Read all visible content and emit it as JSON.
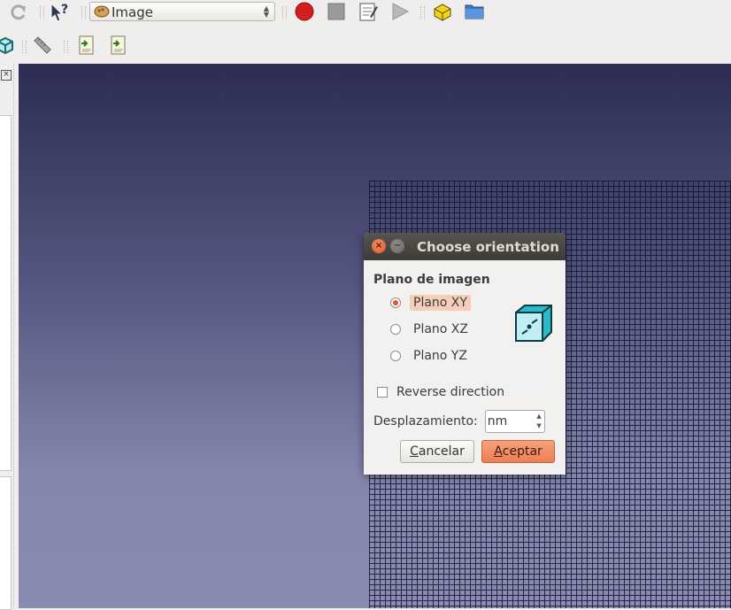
{
  "toolbar_top": {
    "workbench": {
      "selected": "Image",
      "icon": "image-workbench-icon"
    },
    "buttons": [
      "refresh-icon",
      "whats-this-icon",
      "record-macro-icon",
      "stop-macro-icon",
      "edit-macro-icon",
      "run-macro-icon",
      "part-icon",
      "folder-icon"
    ]
  },
  "toolbar_second": {
    "buttons": [
      "3d-view-icon",
      "measure-icon",
      "import-image-icon",
      "import-image-alt-icon"
    ]
  },
  "colors": {
    "accent": "#ee7e52",
    "radio_dot": "#dd5a2a",
    "title_bar": "#3d3b37",
    "viewport_top": "#2d2d52",
    "viewport_bottom": "#8a8bb0"
  },
  "dialog": {
    "title": "Choose orientation",
    "group_label": "Plano de imagen",
    "options": [
      {
        "label": "Plano XY",
        "selected": true
      },
      {
        "label": "Plano XZ",
        "selected": false
      },
      {
        "label": "Plano YZ",
        "selected": false
      }
    ],
    "reverse_label": "Reverse direction",
    "reverse_checked": false,
    "offset_label": "Desplazamiento:",
    "offset_value": "nm",
    "cancel_mnemonic": "C",
    "cancel_rest": "ancelar",
    "accept_mnemonic": "A",
    "accept_rest": "ceptar"
  }
}
